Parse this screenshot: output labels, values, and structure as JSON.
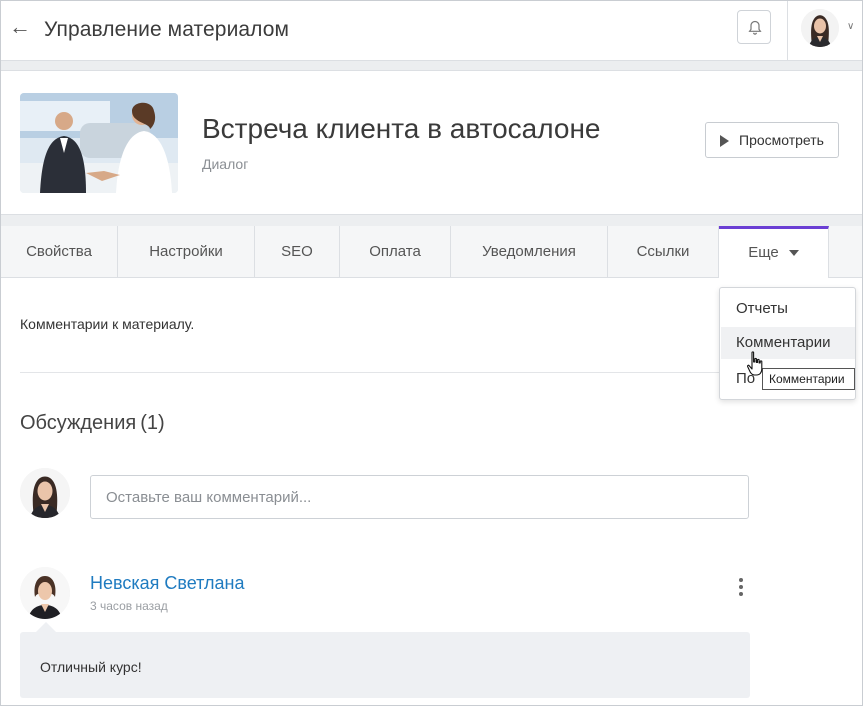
{
  "header": {
    "title": "Управление материалом",
    "back_icon": "arrow-left-icon",
    "bell_icon": "bell-icon"
  },
  "material": {
    "title": "Встреча клиента в автосалоне",
    "subtitle": "Диалог",
    "preview_label": "Просмотреть"
  },
  "tabs": [
    {
      "label": "Свойства"
    },
    {
      "label": "Настройки"
    },
    {
      "label": "SEO"
    },
    {
      "label": "Оплата"
    },
    {
      "label": "Уведомления"
    },
    {
      "label": "Ссылки"
    },
    {
      "label": "Еще",
      "active": true
    }
  ],
  "dropdown": {
    "items": [
      "Отчеты",
      "Комментарии",
      "По"
    ],
    "tooltip": "Комментарии"
  },
  "content": {
    "description": "Комментарии к материалу.",
    "discussions_title": "Обсуждения",
    "discussions_count": "(1)",
    "comment_placeholder": "Оставьте ваш комментарий..."
  },
  "comment": {
    "author": "Невская Светлана",
    "time": "3 часов назад",
    "text": "Отличный курс!"
  },
  "colors": {
    "accent": "#6b3fd4",
    "link": "#1f7bc0",
    "band": "#eceef0"
  }
}
